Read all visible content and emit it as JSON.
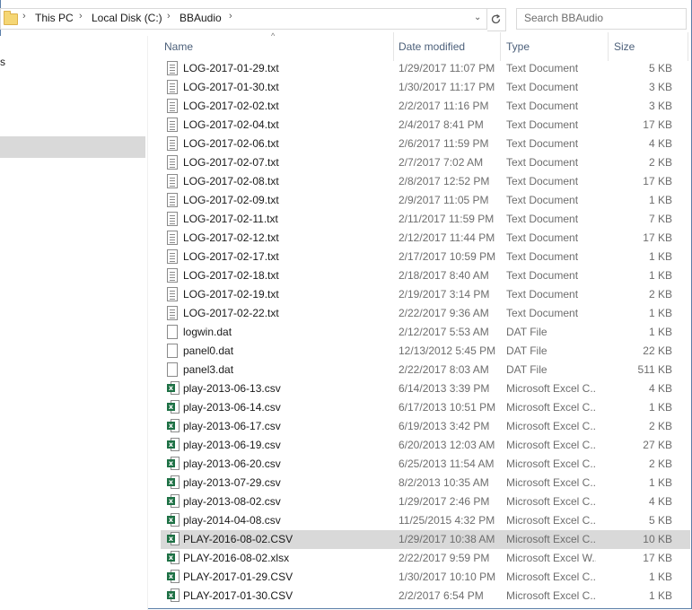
{
  "breadcrumb": [
    "This PC",
    "Local Disk (C:)",
    "BBAudio"
  ],
  "search": {
    "placeholder": "Search BBAudio"
  },
  "nav": {
    "fragment": "s"
  },
  "columns": {
    "name": "Name",
    "date": "Date modified",
    "type": "Type",
    "size": "Size"
  },
  "colors": {
    "selected_row": "#d9d9d9",
    "header_text": "#4c607a",
    "window_border": "#5a7ea8",
    "excel_green": "#1e7145"
  },
  "files": [
    {
      "name": "LOG-2017-01-29.txt",
      "date": "1/29/2017 11:07 PM",
      "type": "Text Document",
      "size": "5 KB",
      "icon": "text-file-icon"
    },
    {
      "name": "LOG-2017-01-30.txt",
      "date": "1/30/2017 11:17 PM",
      "type": "Text Document",
      "size": "3 KB",
      "icon": "text-file-icon"
    },
    {
      "name": "LOG-2017-02-02.txt",
      "date": "2/2/2017 11:16 PM",
      "type": "Text Document",
      "size": "3 KB",
      "icon": "text-file-icon"
    },
    {
      "name": "LOG-2017-02-04.txt",
      "date": "2/4/2017 8:41 PM",
      "type": "Text Document",
      "size": "17 KB",
      "icon": "text-file-icon"
    },
    {
      "name": "LOG-2017-02-06.txt",
      "date": "2/6/2017 11:59 PM",
      "type": "Text Document",
      "size": "4 KB",
      "icon": "text-file-icon"
    },
    {
      "name": "LOG-2017-02-07.txt",
      "date": "2/7/2017 7:02 AM",
      "type": "Text Document",
      "size": "2 KB",
      "icon": "text-file-icon"
    },
    {
      "name": "LOG-2017-02-08.txt",
      "date": "2/8/2017 12:52 PM",
      "type": "Text Document",
      "size": "17 KB",
      "icon": "text-file-icon"
    },
    {
      "name": "LOG-2017-02-09.txt",
      "date": "2/9/2017 11:05 PM",
      "type": "Text Document",
      "size": "1 KB",
      "icon": "text-file-icon"
    },
    {
      "name": "LOG-2017-02-11.txt",
      "date": "2/11/2017 11:59 PM",
      "type": "Text Document",
      "size": "7 KB",
      "icon": "text-file-icon"
    },
    {
      "name": "LOG-2017-02-12.txt",
      "date": "2/12/2017 11:44 PM",
      "type": "Text Document",
      "size": "17 KB",
      "icon": "text-file-icon"
    },
    {
      "name": "LOG-2017-02-17.txt",
      "date": "2/17/2017 10:59 PM",
      "type": "Text Document",
      "size": "1 KB",
      "icon": "text-file-icon"
    },
    {
      "name": "LOG-2017-02-18.txt",
      "date": "2/18/2017 8:40 AM",
      "type": "Text Document",
      "size": "1 KB",
      "icon": "text-file-icon"
    },
    {
      "name": "LOG-2017-02-19.txt",
      "date": "2/19/2017 3:14 PM",
      "type": "Text Document",
      "size": "2 KB",
      "icon": "text-file-icon"
    },
    {
      "name": "LOG-2017-02-22.txt",
      "date": "2/22/2017 9:36 AM",
      "type": "Text Document",
      "size": "1 KB",
      "icon": "text-file-icon"
    },
    {
      "name": "logwin.dat",
      "date": "2/12/2017 5:53 AM",
      "type": "DAT File",
      "size": "1 KB",
      "icon": "blank-file-icon"
    },
    {
      "name": "panel0.dat",
      "date": "12/13/2012 5:45 PM",
      "type": "DAT File",
      "size": "22 KB",
      "icon": "blank-file-icon"
    },
    {
      "name": "panel3.dat",
      "date": "2/22/2017 8:03 AM",
      "type": "DAT File",
      "size": "511 KB",
      "icon": "blank-file-icon"
    },
    {
      "name": "play-2013-06-13.csv",
      "date": "6/14/2013 3:39 PM",
      "type": "Microsoft Excel C...",
      "size": "4 KB",
      "icon": "excel-file-icon"
    },
    {
      "name": "play-2013-06-14.csv",
      "date": "6/17/2013 10:51 PM",
      "type": "Microsoft Excel C...",
      "size": "1 KB",
      "icon": "excel-file-icon"
    },
    {
      "name": "play-2013-06-17.csv",
      "date": "6/19/2013 3:42 PM",
      "type": "Microsoft Excel C...",
      "size": "2 KB",
      "icon": "excel-file-icon"
    },
    {
      "name": "play-2013-06-19.csv",
      "date": "6/20/2013 12:03 AM",
      "type": "Microsoft Excel C...",
      "size": "27 KB",
      "icon": "excel-file-icon"
    },
    {
      "name": "play-2013-06-20.csv",
      "date": "6/25/2013 11:54 AM",
      "type": "Microsoft Excel C...",
      "size": "2 KB",
      "icon": "excel-file-icon"
    },
    {
      "name": "play-2013-07-29.csv",
      "date": "8/2/2013 10:35 AM",
      "type": "Microsoft Excel C...",
      "size": "1 KB",
      "icon": "excel-file-icon"
    },
    {
      "name": "play-2013-08-02.csv",
      "date": "1/29/2017 2:46 PM",
      "type": "Microsoft Excel C...",
      "size": "4 KB",
      "icon": "excel-file-icon"
    },
    {
      "name": "play-2014-04-08.csv",
      "date": "11/25/2015 4:32 PM",
      "type": "Microsoft Excel C...",
      "size": "5 KB",
      "icon": "excel-file-icon"
    },
    {
      "name": "PLAY-2016-08-02.CSV",
      "date": "1/29/2017 10:38 AM",
      "type": "Microsoft Excel C...",
      "size": "10 KB",
      "icon": "excel-file-icon",
      "selected": true
    },
    {
      "name": "PLAY-2016-08-02.xlsx",
      "date": "2/22/2017 9:59 PM",
      "type": "Microsoft Excel W...",
      "size": "17 KB",
      "icon": "excel-file-icon"
    },
    {
      "name": "PLAY-2017-01-29.CSV",
      "date": "1/30/2017 10:10 PM",
      "type": "Microsoft Excel C...",
      "size": "1 KB",
      "icon": "excel-file-icon"
    },
    {
      "name": "PLAY-2017-01-30.CSV",
      "date": "2/2/2017 6:54 PM",
      "type": "Microsoft Excel C...",
      "size": "1 KB",
      "icon": "excel-file-icon"
    }
  ]
}
